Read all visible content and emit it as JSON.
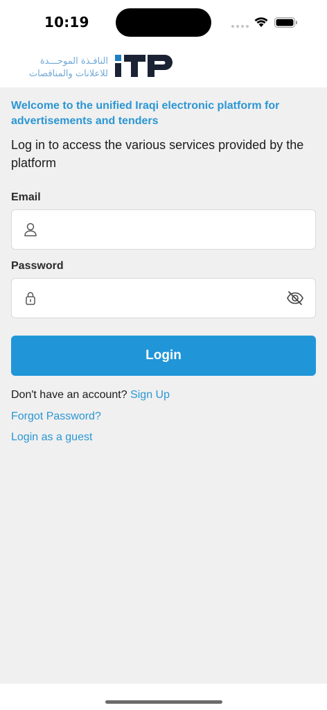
{
  "status_bar": {
    "time": "10:19"
  },
  "header": {
    "logo_text": "ITP",
    "logo_arabic_line1": "النافـذة الموحـــدة",
    "logo_arabic_line2": "للاعلانات والمناقصات"
  },
  "login": {
    "welcome": "Welcome to the unified Iraqi electronic platform for advertisements and tenders",
    "subtitle": "Log in to access the various services provided by the platform",
    "email_label": "Email",
    "email_value": "",
    "password_label": "Password",
    "password_value": "",
    "login_button": "Login",
    "no_account_text": "Don't have an account?",
    "signup_link": "Sign Up",
    "forgot_password": "Forgot Password?",
    "guest_login": "Login as a guest"
  },
  "colors": {
    "accent": "#2096d8",
    "link": "#2b96d3",
    "background": "#f0f0f0"
  },
  "icons": {
    "user": "user-icon",
    "lock": "lock-icon",
    "eye_off": "eye-off-icon"
  }
}
